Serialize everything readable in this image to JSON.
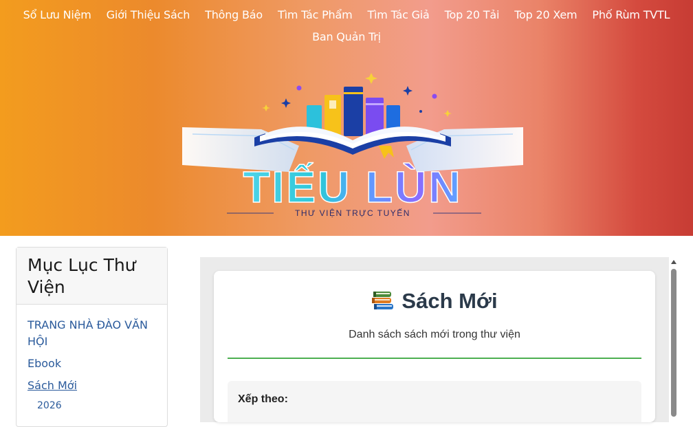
{
  "nav": {
    "items": [
      "Sổ Lưu Niệm",
      "Giới Thiệu Sách",
      "Thông Báo",
      "Tìm Tác Phẩm",
      "Tìm Tác Giả",
      "Top 20 Tải",
      "Top 20 Xem",
      "Phố Rùm TVTL",
      "Ban Quản Trị"
    ]
  },
  "logo": {
    "title": "TIẾU LÙN",
    "tagline": "THƯ VIỆN TRỰC TUYẾN"
  },
  "sidebar": {
    "title": "Mục Lục Thư Viện",
    "items": [
      {
        "label": "TRANG NHÀ ĐÀO VĂN HỘI"
      },
      {
        "label": "Ebook"
      },
      {
        "label": "Sách Mới"
      }
    ],
    "sub_items": [
      "2026"
    ]
  },
  "main": {
    "title": "Sách Mới",
    "subtitle": "Danh sách sách mới trong thư viện",
    "sort_label": "Xếp theo:"
  },
  "colors": {
    "accent_rule": "#4caf50",
    "link": "#2a5a9b",
    "header_left": "#f39c1e",
    "header_right": "#c73c34"
  },
  "icons": {
    "section_title": "books-icon",
    "scroll": "scroll-up-arrow-icon"
  }
}
